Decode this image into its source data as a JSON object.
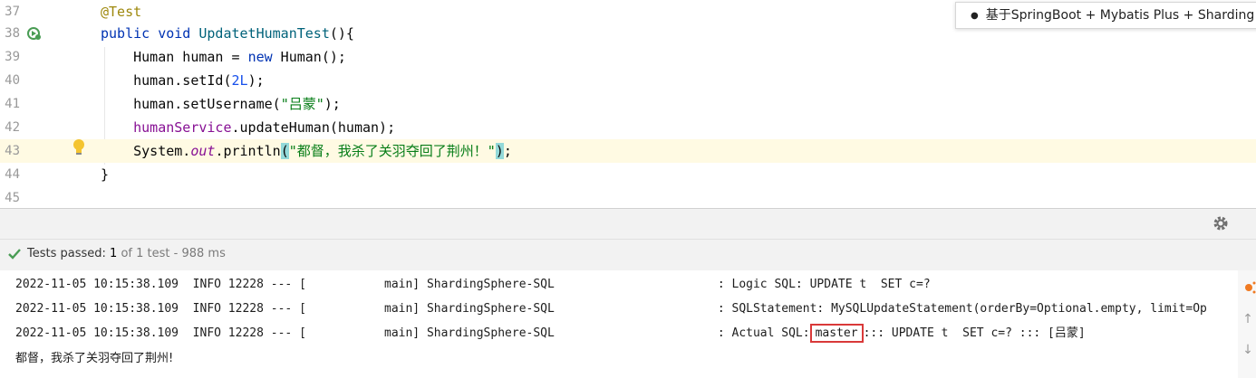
{
  "editor": {
    "lines": [
      {
        "num": "37"
      },
      {
        "num": "38"
      },
      {
        "num": "39"
      },
      {
        "num": "40"
      },
      {
        "num": "41"
      },
      {
        "num": "42"
      },
      {
        "num": "43"
      },
      {
        "num": "44"
      },
      {
        "num": "45"
      }
    ],
    "code": {
      "l37_annotation": "@Test",
      "l38_public": "public",
      "l38_void": "void",
      "l38_method": "UpdatetHumanTest",
      "l38_rest": "(){",
      "l39_type": "Human human = ",
      "l39_new": "new",
      "l39_rest": " Human();",
      "l40_call": "human.setId(",
      "l40_num": "2L",
      "l40_end": ");",
      "l41_call": "human.setUsername(",
      "l41_str": "\"吕蒙\"",
      "l41_end": ");",
      "l42_field": "humanService",
      "l42_rest": ".updateHuman(human);",
      "l43_system": "System.",
      "l43_out": "out",
      "l43_println": ".println",
      "l43_open": "(",
      "l43_str": "\"都督，我杀了关羽夺回了荆州！\"",
      "l43_close": ")",
      "l43_end": ";",
      "l44_brace": "}"
    },
    "tooltip": "基于SpringBoot + Mybatis Plus + Sharding"
  },
  "tests": {
    "label": "Tests passed: ",
    "passed": "1",
    "of_total": "of 1 test",
    "duration": " - 988 ms"
  },
  "console": {
    "line1": "2022-11-05 10:15:38.109  INFO 12228 --- [           main] ShardingSphere-SQL                       : Logic SQL: UPDATE t  SET c=?",
    "line2": "2022-11-05 10:15:38.109  INFO 12228 --- [           main] ShardingSphere-SQL                       : SQLStatement: MySQLUpdateStatement(orderBy=Optional.empty, limit=Op",
    "line3_prefix": "2022-11-05 10:15:38.109  INFO 12228 --- [           main] ShardingSphere-SQL                       : Actual SQL:",
    "line3_highlight": "master",
    "line3_suffix": "::: UPDATE t  SET c=? ::: [吕蒙]",
    "line4": "都督，我杀了关羽夺回了荆州!"
  },
  "colors": {
    "keyword": "#0033b3",
    "string": "#067d17",
    "annotation": "#9e880d",
    "highlight_box": "#d93939",
    "pass_green": "#499c54"
  },
  "icons": [
    "run-test-icon",
    "lightbulb-icon",
    "gear-icon",
    "check-icon",
    "scroll-up-icon",
    "scroll-down-icon"
  ]
}
